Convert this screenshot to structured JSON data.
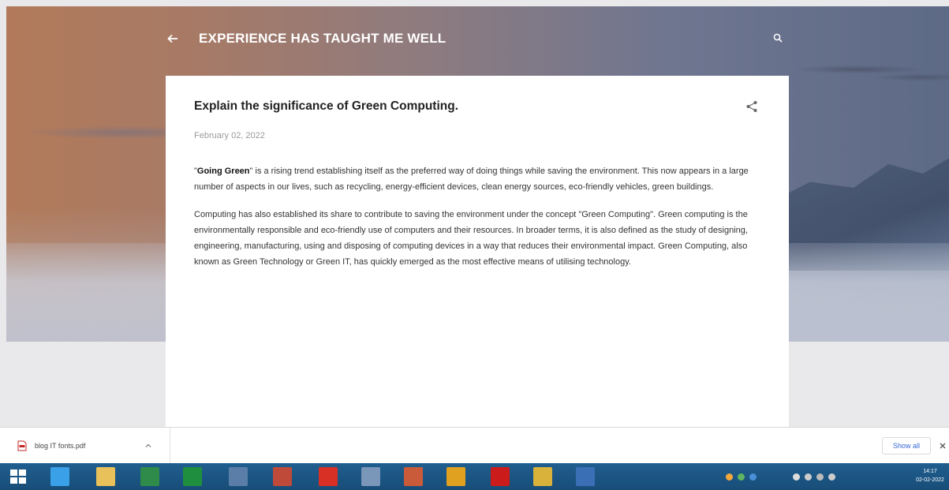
{
  "header": {
    "blog_title": "EXPERIENCE HAS TAUGHT ME WELL",
    "icons": {
      "back": "arrow-left-icon",
      "search": "search-icon"
    }
  },
  "post": {
    "title": "Explain the significance of Green Computing.",
    "date": "February 02, 2022",
    "share_icon": "share-icon",
    "paragraph1_bold": "Going Green",
    "paragraph1_open_quote": "\"",
    "paragraph1_close_quote": "\"",
    "paragraph1_rest": " is a rising trend establishing itself as the preferred way of doing things while saving the environment. This now appears in a large number of aspects in our lives, such as recycling, energy-efficient devices, clean energy sources, eco-friendly vehicles, green buildings.",
    "paragraph2": "Computing has also established its share to contribute to saving the environment under the concept \"Green Computing\". Green computing is the environmentally responsible and eco-friendly use of computers and their resources. In broader terms, it is also defined as the study of designing, engineering, manufacturing, using and disposing of computing devices in a way that reduces their environmental impact. Green Computing, also known as Green Technology or Green IT, has quickly emerged as the most effective means of utilising technology."
  },
  "downloads": {
    "file_name": "blog IT fonts.pdf",
    "show_all_label": "Show all",
    "icons": {
      "file": "pdf-file-icon",
      "menu": "chevron-up-icon",
      "close": "close-icon"
    }
  },
  "taskbar": {
    "apps": [
      {
        "name": "internet-explorer-icon",
        "color": "#3aa0e8"
      },
      {
        "name": "file-explorer-icon",
        "color": "#e8c15a"
      },
      {
        "name": "excel-icon",
        "color": "#2e8b4a"
      },
      {
        "name": "access-icon",
        "color": "#1f8f3f"
      },
      {
        "name": "media-icon",
        "color": "#5b7ea8"
      },
      {
        "name": "word-doc-icon",
        "color": "#c04a3a"
      },
      {
        "name": "anydesk-icon",
        "color": "#d93025"
      },
      {
        "name": "notepad-icon",
        "color": "#7a96b8"
      },
      {
        "name": "powerpoint-icon",
        "color": "#c95b3a"
      },
      {
        "name": "chrome-icon",
        "color": "#e0a020"
      },
      {
        "name": "opera-icon",
        "color": "#cc1b1b"
      },
      {
        "name": "app-icon-yellow",
        "color": "#d8b23a"
      },
      {
        "name": "paint-icon",
        "color": "#3b6fb5"
      }
    ],
    "clock_time": "14:17",
    "clock_date": "02-02-2022"
  }
}
